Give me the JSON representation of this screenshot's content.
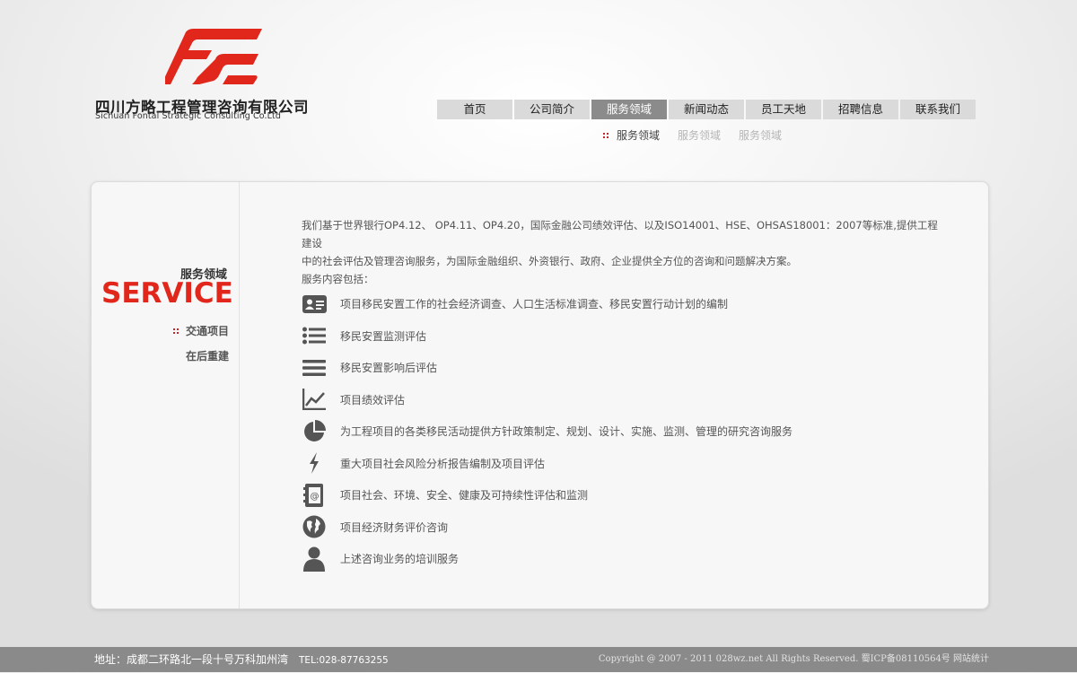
{
  "brand": {
    "name_cn": "四川方略工程管理咨询有限公司",
    "name_en": "Sichuan Fontal Strategic  Consulting Co.Ltd",
    "logo_color": "#e1261c"
  },
  "nav": {
    "items": [
      {
        "label": "首页"
      },
      {
        "label": "公司简介"
      },
      {
        "label": "服务领域",
        "active": true
      },
      {
        "label": "新闻动态"
      },
      {
        "label": "员工天地"
      },
      {
        "label": "招聘信息"
      },
      {
        "label": "联系我们"
      }
    ],
    "sub_items": [
      {
        "label": "服务领域",
        "active": true
      },
      {
        "label": "服务领域"
      },
      {
        "label": "服务领域"
      }
    ]
  },
  "sidebar": {
    "heading_cn": "服务领域",
    "heading_en": "SERVICE",
    "items": [
      {
        "label": "交通项目",
        "active": true
      },
      {
        "label": "在后重建"
      }
    ]
  },
  "main": {
    "intro_line1": "我们基于世界银行OP4.12、 OP4.11、OP4.20，国际金融公司绩效评估、以及ISO14001、HSE、OHSAS18001：2007等标准,提供工程建设",
    "intro_line2": "中的社会评估及管理咨询服务，为国际金融组织、外资银行、政府、企业提供全方位的咨询和问题解决方案。",
    "intro_line3": "服务内容包括：",
    "services": [
      {
        "icon": "id-card-icon",
        "text": "项目移民安置工作的社会经济调查、人口生活标准调查、移民安置行动计划的编制"
      },
      {
        "icon": "list-icon",
        "text": "移民安置监测评估"
      },
      {
        "icon": "menu-lines-icon",
        "text": "移民安置影响后评估"
      },
      {
        "icon": "line-chart-icon",
        "text": "项目绩效评估"
      },
      {
        "icon": "pie-chart-icon",
        "text": "为工程项目的各类移民活动提供方针政策制定、规划、设计、实施、监测、管理的研究咨询服务"
      },
      {
        "icon": "lightning-icon",
        "text": "重大项目社会风险分析报告编制及项目评估"
      },
      {
        "icon": "address-book-icon",
        "text": "项目社会、环境、安全、健康及可持续性评估和监测"
      },
      {
        "icon": "globe-icon",
        "text": "项目经济财务评价咨询"
      },
      {
        "icon": "users-icon",
        "text": "上述咨询业务的培训服务"
      }
    ]
  },
  "footer": {
    "address": "地址：成都二环路北一段十号万科加州湾",
    "tel": "TEL:028-87763255",
    "copyright": "Copyright @ 2007 - 2011 028wz.net All Rights Reserved. ",
    "icp": "蜀ICP备08110564号",
    "stats": "网站统计"
  }
}
